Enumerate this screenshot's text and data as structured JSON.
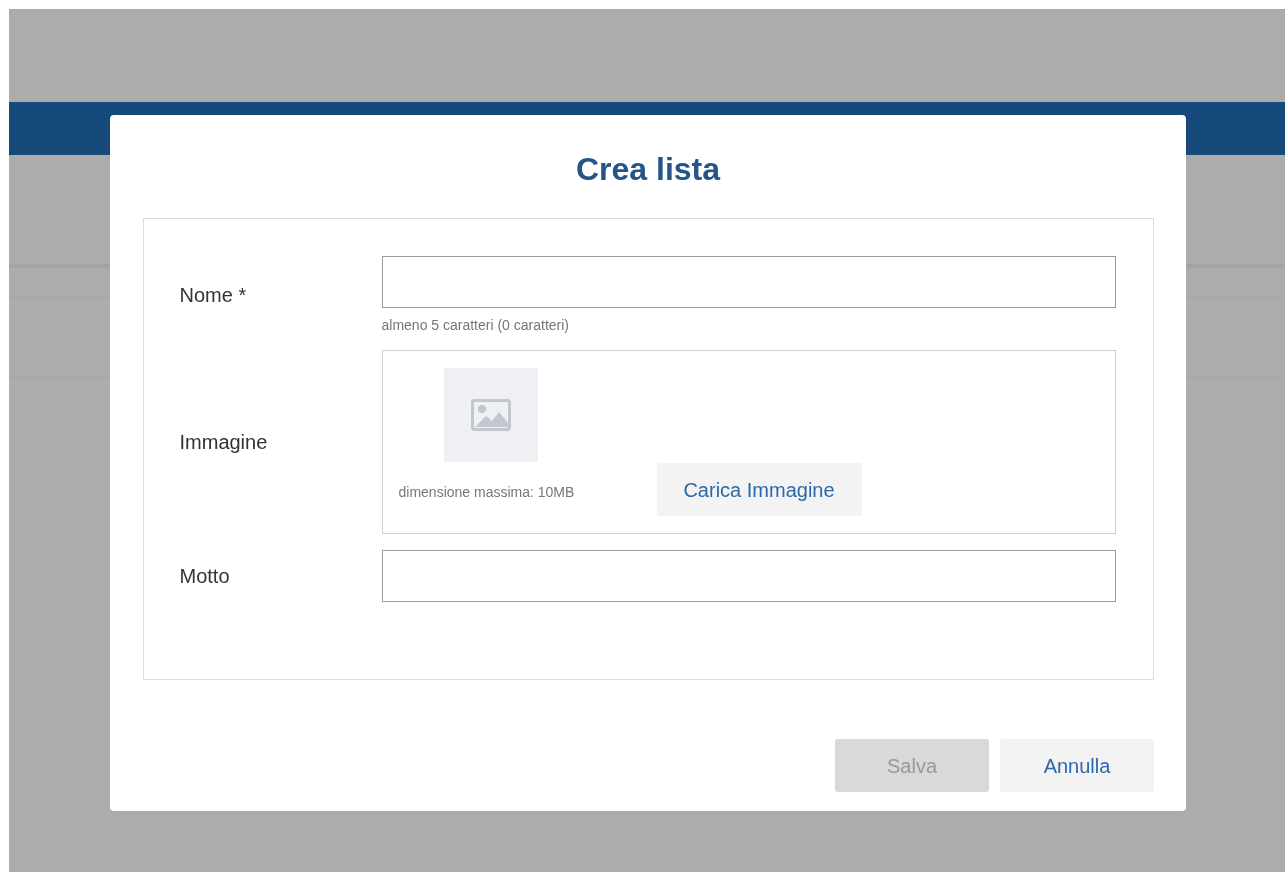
{
  "dialog": {
    "title": "Crea lista",
    "fields": [
      {
        "kind": "text",
        "label": "Nome *",
        "hint": "almeno 5 caratteri (0 caratteri)"
      },
      {
        "kind": "image",
        "label": "Immagine",
        "hint": "dimensione massima: 10MB",
        "button": "Carica Immagine"
      },
      {
        "kind": "text",
        "label": "Motto"
      }
    ],
    "buttons": [
      {
        "label": "Salva",
        "disabled": true
      },
      {
        "label": "Annulla",
        "disabled": false
      }
    ]
  }
}
